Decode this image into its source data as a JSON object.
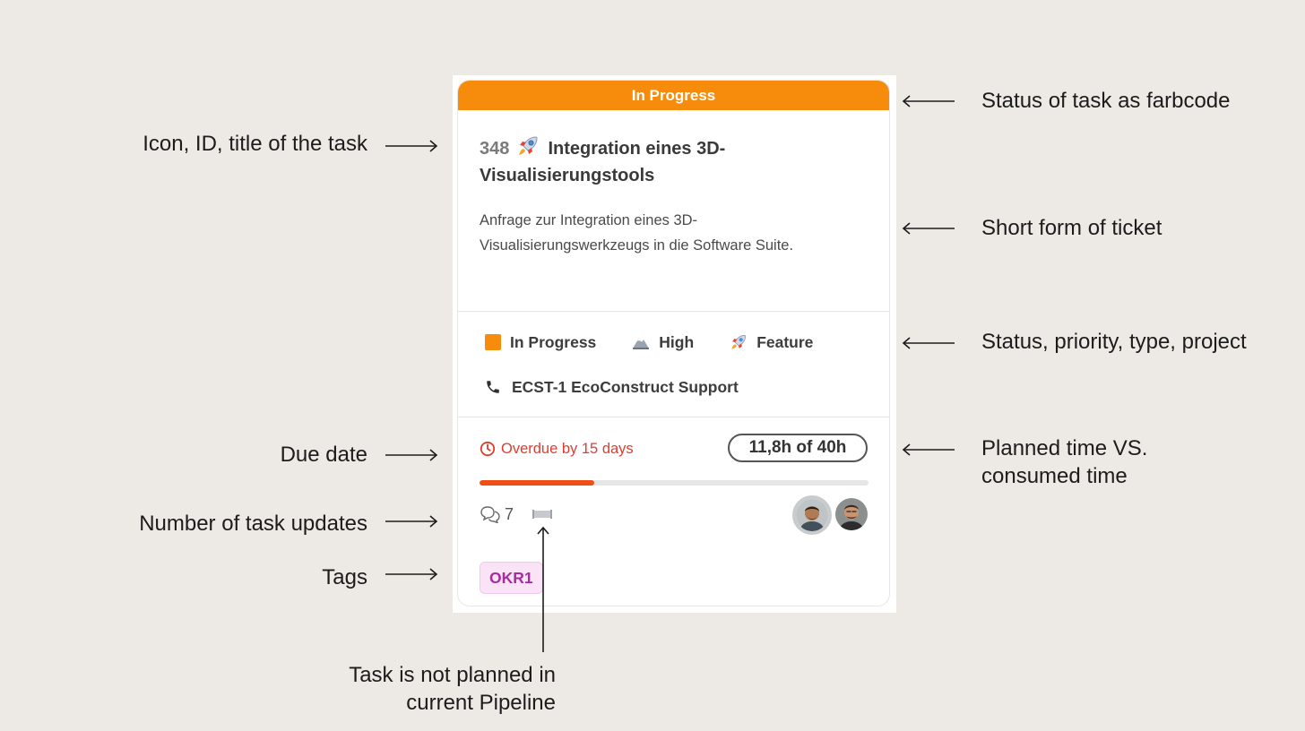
{
  "card": {
    "status_header": "In Progress",
    "task_id": "348",
    "task_title": "Integration eines 3D-Visualisierungstools",
    "description": "Anfrage zur Integration eines 3D-Visualisierungswerkzeugs in die Software Suite.",
    "properties": {
      "status": "In Progress",
      "priority": "High",
      "type": "Feature",
      "project": "ECST-1 EcoConstruct Support"
    },
    "due": "Overdue by 15 days",
    "time_summary": "11,8h of 40h",
    "time_progress_fraction": 0.295,
    "updates_count": "7",
    "tag": "OKR1",
    "icons": {
      "type_icon": "rocket-icon",
      "priority_icon": "mountain-icon",
      "project_icon": "phone-icon",
      "due_icon": "clock-icon",
      "updates_icon": "comments-icon",
      "pipeline_icon": "pipeline-icon"
    },
    "colors": {
      "status_orange": "#f78c0c",
      "overdue_red": "#e03c2e",
      "progress_fill": "#ef4e16",
      "tag_bg": "#fae3f6",
      "tag_text": "#a52da0"
    }
  },
  "annotations": {
    "status_color": "Status of task as farbcode",
    "title": "Icon, ID, title of the task",
    "short_form": "Short form of ticket",
    "properties": "Status, priority, type, project",
    "due_date": "Due date",
    "time_line1": "Planned time VS.",
    "time_line2": "consumed time",
    "updates": "Number of task updates",
    "tags": "Tags",
    "pipeline_line1": "Task is not planned in",
    "pipeline_line2": "current Pipeline"
  }
}
